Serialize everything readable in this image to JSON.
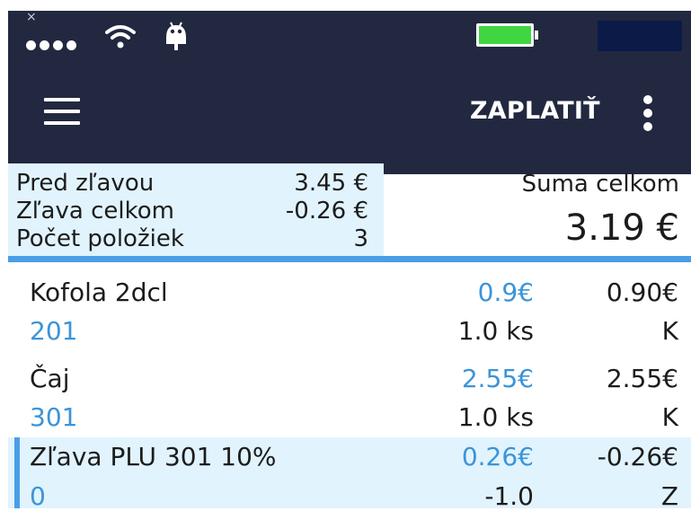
{
  "status_bar": {
    "close_glyph": "×",
    "wifi_icon": "wifi-icon",
    "robot_icon": "android-debug-icon",
    "battery_color": "#3fd642",
    "bar_color": "#222840"
  },
  "toolbar": {
    "menu_icon": "hamburger-menu-icon",
    "pay_label": "ZAPLATIŤ",
    "more_icon": "more-vert-icon"
  },
  "summary": {
    "rows": [
      {
        "label": "Pred zľavou",
        "value": "3.45 €"
      },
      {
        "label": "Zľava celkom",
        "value": "-0.26 €"
      },
      {
        "label": "Počet položiek",
        "value": "3"
      }
    ],
    "total_label": "Suma celkom",
    "total_value": "3.19 €"
  },
  "items": [
    {
      "name": "Kofola 2dcl",
      "plu": "201",
      "unit_price": "0.9€",
      "quantity": "1.0 ks",
      "total": "0.90€",
      "tax": "K"
    },
    {
      "name": "Čaj",
      "plu": "301",
      "unit_price": "2.55€",
      "quantity": "1.0 ks",
      "total": "2.55€",
      "tax": "K"
    },
    {
      "name": "Zľava PLU 301 10%",
      "plu": "0",
      "unit_price": "0.26€",
      "quantity": "-1.0",
      "total": "-0.26€",
      "tax": "Z"
    }
  ],
  "colors": {
    "accent": "#4a9ee8",
    "highlight": "#e1f3fd",
    "link_text": "#3b94d8"
  }
}
